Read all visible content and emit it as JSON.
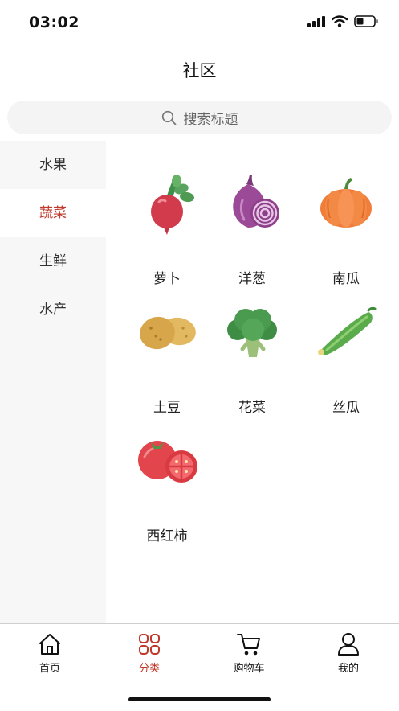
{
  "status": {
    "time": "03:02"
  },
  "header": {
    "title": "社区"
  },
  "search": {
    "placeholder": "搜索标题"
  },
  "sidebar": {
    "items": [
      {
        "label": "水果",
        "active": false
      },
      {
        "label": "蔬菜",
        "active": true
      },
      {
        "label": "生鲜",
        "active": false
      },
      {
        "label": "水产",
        "active": false
      }
    ]
  },
  "products": [
    {
      "name": "萝卜",
      "icon": "radish-icon"
    },
    {
      "name": "洋葱",
      "icon": "onion-icon"
    },
    {
      "name": "南瓜",
      "icon": "pumpkin-icon"
    },
    {
      "name": "土豆",
      "icon": "potato-icon"
    },
    {
      "name": "花菜",
      "icon": "broccoli-icon"
    },
    {
      "name": "丝瓜",
      "icon": "loofah-icon"
    },
    {
      "name": "西红柿",
      "icon": "tomato-icon"
    }
  ],
  "tabbar": {
    "tabs": [
      {
        "label": "首页",
        "icon": "home-icon",
        "active": false
      },
      {
        "label": "分类",
        "icon": "category-icon",
        "active": true
      },
      {
        "label": "购物车",
        "icon": "cart-icon",
        "active": false
      },
      {
        "label": "我的",
        "icon": "user-icon",
        "active": false
      }
    ]
  },
  "colors": {
    "accent": "#c0392b",
    "sidebar_bg": "#f7f7f7",
    "search_bg": "#f4f4f4"
  }
}
